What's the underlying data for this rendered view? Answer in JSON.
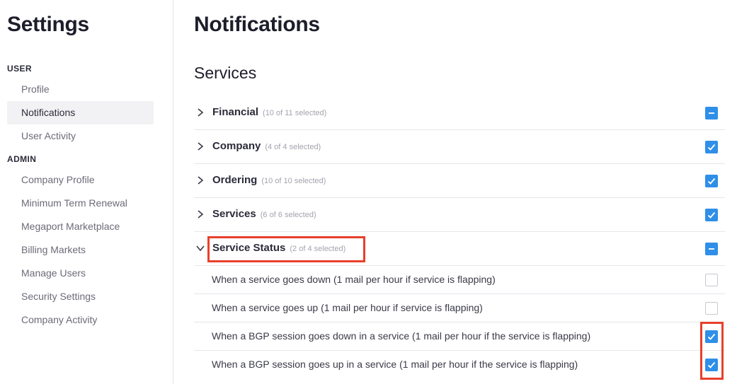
{
  "sidebar": {
    "title": "Settings",
    "sections": [
      {
        "label": "USER",
        "items": [
          {
            "label": "Profile",
            "active": false
          },
          {
            "label": "Notifications",
            "active": true
          },
          {
            "label": "User Activity",
            "active": false
          }
        ]
      },
      {
        "label": "ADMIN",
        "items": [
          {
            "label": "Company Profile",
            "active": false
          },
          {
            "label": "Minimum Term Renewal",
            "active": false
          },
          {
            "label": "Megaport Marketplace",
            "active": false
          },
          {
            "label": "Billing Markets",
            "active": false
          },
          {
            "label": "Manage Users",
            "active": false
          },
          {
            "label": "Security Settings",
            "active": false
          },
          {
            "label": "Company Activity",
            "active": false
          }
        ]
      }
    ]
  },
  "main": {
    "title": "Notifications",
    "section_title": "Services",
    "categories": [
      {
        "name": "Financial",
        "count": "(10 of 11 selected)",
        "state": "partial",
        "expanded": false
      },
      {
        "name": "Company",
        "count": "(4 of 4 selected)",
        "state": "checked",
        "expanded": false
      },
      {
        "name": "Ordering",
        "count": "(10 of 10 selected)",
        "state": "checked",
        "expanded": false
      },
      {
        "name": "Services",
        "count": "(6 of 6 selected)",
        "state": "checked",
        "expanded": false
      },
      {
        "name": "Service Status",
        "count": "(2 of 4 selected)",
        "state": "partial",
        "expanded": true
      }
    ],
    "service_status_options": [
      {
        "label": "When a service goes down (1 mail per hour if service is flapping)",
        "checked": false
      },
      {
        "label": "When a service goes up (1 mail per hour if service is flapping)",
        "checked": false
      },
      {
        "label": "When a BGP session goes down in a service (1 mail per hour if the service is flapping)",
        "checked": true
      },
      {
        "label": "When a BGP session goes up in a service (1 mail per hour if the service is flapping)",
        "checked": true
      }
    ]
  },
  "colors": {
    "checkbox_blue": "#2f8fe8",
    "highlight_red": "#e8402b"
  }
}
